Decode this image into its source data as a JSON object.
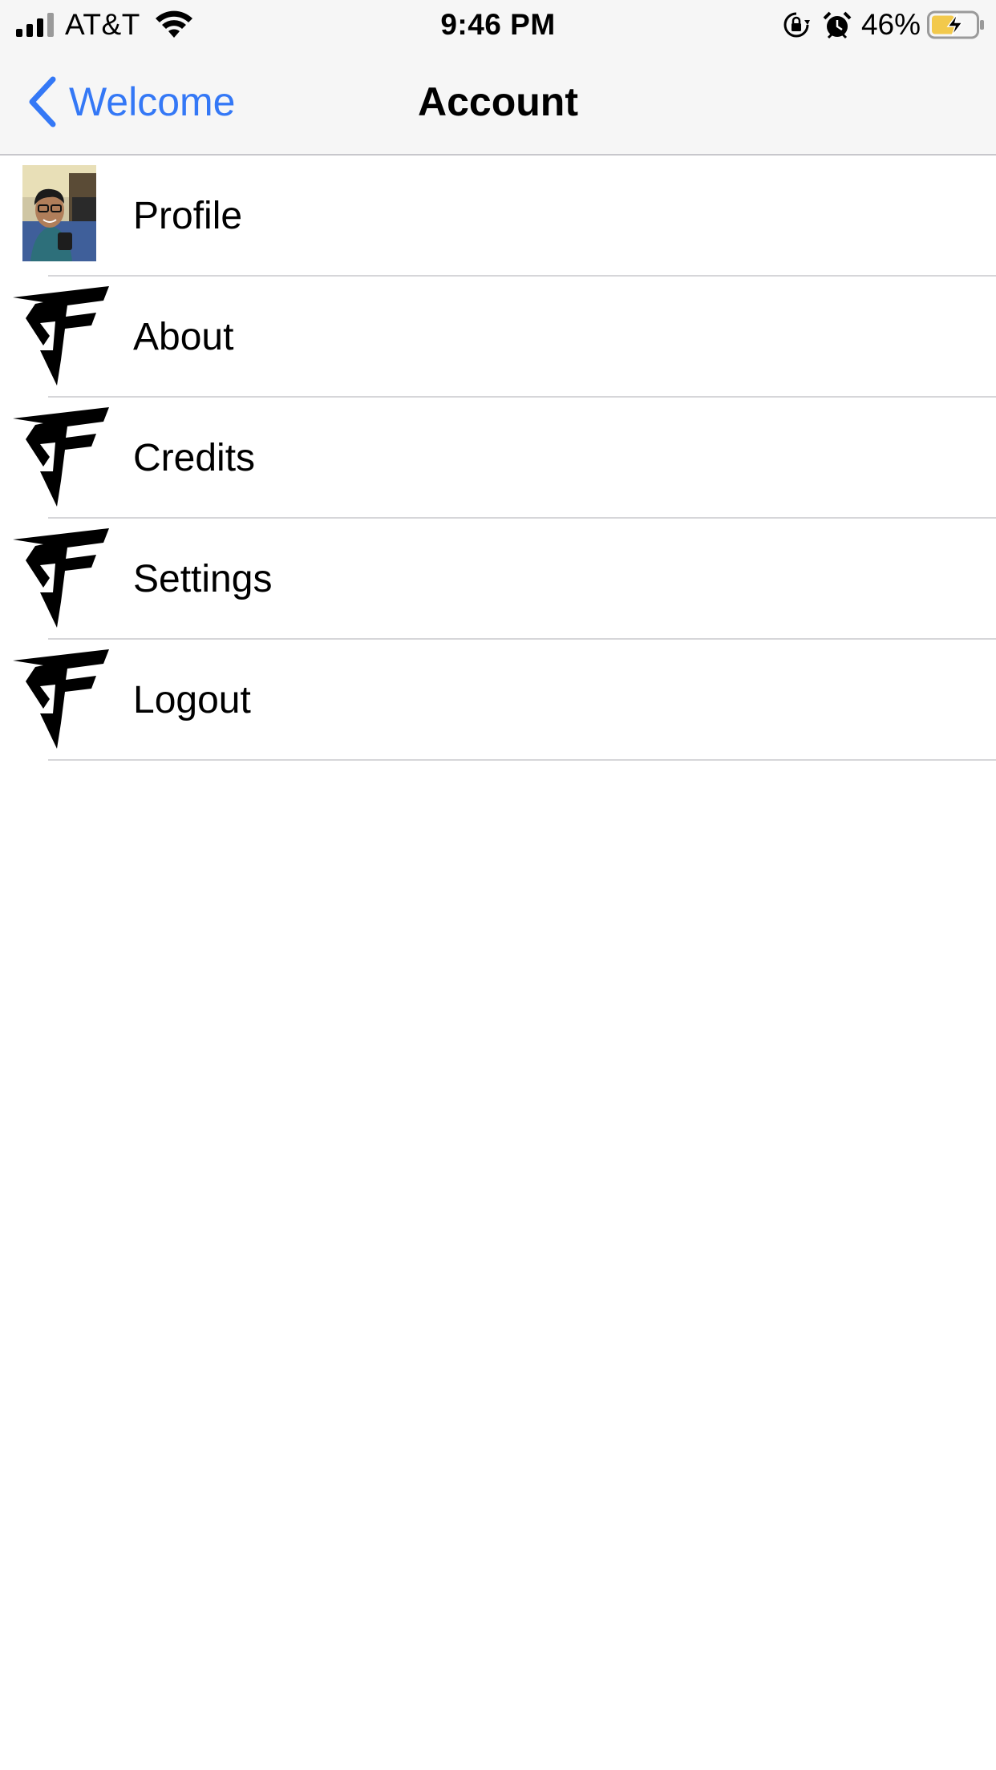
{
  "status_bar": {
    "carrier": "AT&T",
    "time": "9:46 PM",
    "battery_percent": "46%",
    "signal_bars": 3,
    "icons": [
      "signal-icon",
      "wifi-icon",
      "orientation-lock-icon",
      "alarm-icon",
      "battery-charging-icon"
    ]
  },
  "nav": {
    "back_label": "Welcome",
    "title": "Account"
  },
  "menu": {
    "items": [
      {
        "label": "Profile",
        "icon": "profile-photo"
      },
      {
        "label": "About",
        "icon": "sf-logo-icon"
      },
      {
        "label": "Credits",
        "icon": "sf-logo-icon"
      },
      {
        "label": "Settings",
        "icon": "sf-logo-icon"
      },
      {
        "label": "Logout",
        "icon": "sf-logo-icon"
      }
    ]
  },
  "colors": {
    "accent": "#3478f6",
    "bar_background": "#f6f6f6",
    "separator": "#d6d6d9",
    "battery_fill": "#f2c94c"
  }
}
